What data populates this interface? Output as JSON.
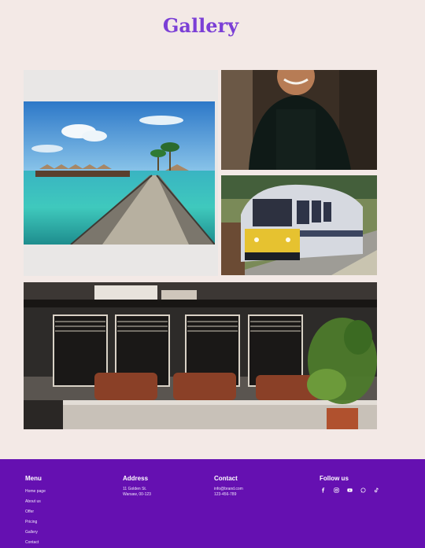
{
  "page": {
    "title": "Gallery"
  },
  "gallery": {
    "images": [
      {
        "name": "overwater-villas-pier",
        "depicts": "tropical pier leading to overwater villas"
      },
      {
        "name": "smiling-man-black-apron",
        "depicts": "smiling man in black apron"
      },
      {
        "name": "commuter-train-platform",
        "depicts": "yellow-fronted commuter train at platform"
      },
      {
        "name": "cafe-interior-plant",
        "depicts": "cafe interior with chairs and potted plant"
      }
    ]
  },
  "footer": {
    "menu": {
      "heading": "Menu",
      "items": [
        "Home page",
        "About us",
        "Offer",
        "Pricing",
        "Gallery",
        "Contact"
      ]
    },
    "address": {
      "heading": "Address",
      "line1": "11 Golden St.",
      "line2": "Warsaw, 00-123"
    },
    "contact": {
      "heading": "Contact",
      "email": "info@brand.com",
      "phone": "123-456-789"
    },
    "follow": {
      "heading": "Follow us",
      "icons": [
        "facebook-icon",
        "instagram-icon",
        "youtube-icon",
        "whatsapp-icon",
        "tiktok-icon"
      ]
    }
  },
  "colors": {
    "background": "#f3e9e6",
    "accent": "#7b3fd6",
    "footer": "#6510b1"
  }
}
